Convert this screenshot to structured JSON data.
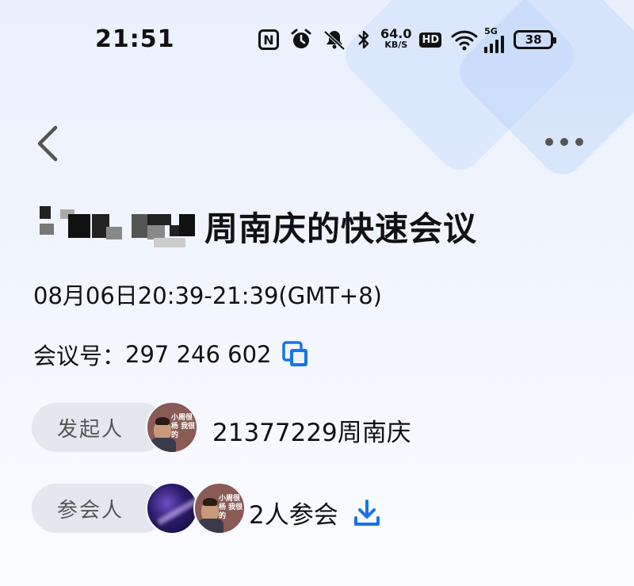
{
  "status_bar": {
    "time": "21:51",
    "net_speed_value": "64.0",
    "net_speed_unit": "KB/S",
    "hd_label": "HD",
    "network_type": "5G",
    "battery": "38",
    "icons": [
      "nfc-icon",
      "alarm-icon",
      "mute-icon",
      "bluetooth-icon",
      "wifi-icon",
      "signal-icon",
      "battery-icon"
    ]
  },
  "nav": {
    "back_icon": "chevron-left-icon",
    "more_icon": "more-dots-icon"
  },
  "meeting": {
    "title_suffix": "周南庆的快速会议",
    "datetime": "08月06日20:39-21:39(GMT+8)",
    "id_label": "会议号：",
    "id_value": "297 246 602"
  },
  "host": {
    "label": "发起人",
    "name": "21377229周南庆",
    "avatar_caption": "小周很杨 我很的"
  },
  "participants": {
    "label": "参会人",
    "count_text": "2人参会"
  },
  "colors": {
    "accent": "#1a73e8",
    "pill_bg": "#e4e7ee",
    "background_top": "#eaf1fd"
  }
}
